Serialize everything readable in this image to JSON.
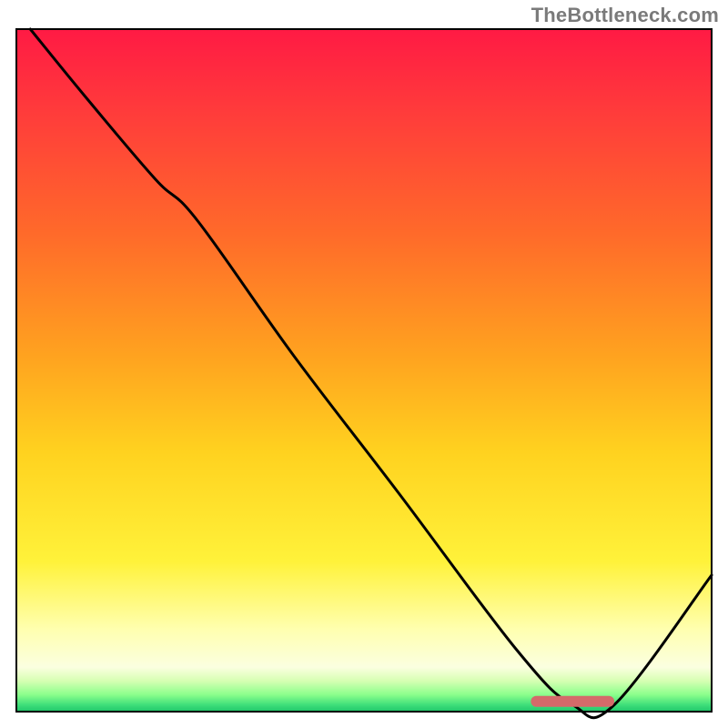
{
  "watermark": "TheBottleneck.com",
  "chart_data": {
    "type": "line",
    "title": "",
    "xlabel": "",
    "ylabel": "",
    "xlim": [
      0,
      100
    ],
    "ylim": [
      0,
      100
    ],
    "grid": false,
    "legend": false,
    "curve": {
      "name": "bottleneck-curve",
      "x": [
        2,
        10,
        20,
        26,
        40,
        55,
        72,
        80,
        86,
        100
      ],
      "y": [
        100,
        90,
        78,
        72,
        52,
        32,
        9,
        1,
        1,
        20
      ]
    },
    "marker": {
      "name": "optimal-range",
      "x_start": 74,
      "x_end": 86,
      "y": 1.5,
      "color": "#d46a6a"
    },
    "gradient_stops": [
      {
        "offset": 0.0,
        "color": "#ff1a44"
      },
      {
        "offset": 0.12,
        "color": "#ff3b3b"
      },
      {
        "offset": 0.3,
        "color": "#ff6a2a"
      },
      {
        "offset": 0.48,
        "color": "#ffa31f"
      },
      {
        "offset": 0.62,
        "color": "#ffd21f"
      },
      {
        "offset": 0.78,
        "color": "#fff23a"
      },
      {
        "offset": 0.88,
        "color": "#ffffb0"
      },
      {
        "offset": 0.935,
        "color": "#fbffe0"
      },
      {
        "offset": 0.955,
        "color": "#d6ffb3"
      },
      {
        "offset": 0.975,
        "color": "#8cff8c"
      },
      {
        "offset": 0.99,
        "color": "#3fdf7a"
      },
      {
        "offset": 1.0,
        "color": "#20c66a"
      }
    ]
  }
}
